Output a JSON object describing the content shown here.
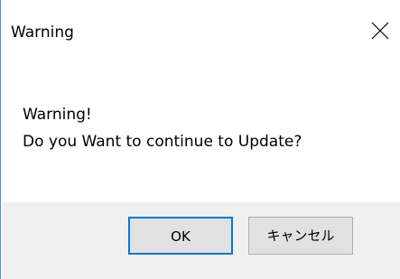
{
  "dialog": {
    "title": "Warning",
    "close_icon": "close-icon",
    "message_line1": "Warning!",
    "message_line2": "Do you Want to continue to Update?",
    "ok_label": "OK",
    "cancel_label": "キャンセル"
  },
  "colors": {
    "window_border": "#4a8fd6",
    "footer_bg": "#f0f0f0",
    "button_bg": "#e1e1e1",
    "default_button_border": "#0078d7",
    "button_border": "#adadad"
  }
}
